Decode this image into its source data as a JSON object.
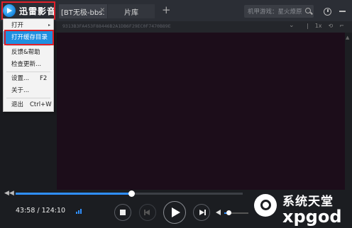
{
  "app": {
    "name": "迅雷影音"
  },
  "tabs": [
    {
      "label": "[BT无极-bbs.",
      "close": "✕"
    },
    {
      "label": "片库"
    }
  ],
  "tab_add": "+",
  "search": {
    "placeholder": "机甲游戏：星火燎原"
  },
  "address": {
    "hash": "9313B3FA453F88446B2A1DB6F29EC0F7470B89E",
    "chevron": "⌄",
    "tools": [
      "|",
      "1x",
      "⟲",
      "⌐"
    ]
  },
  "menu": {
    "items": [
      {
        "label": "打开",
        "arrow": "▸"
      },
      {
        "label": "打开缓存目录"
      },
      {
        "label": "反馈&帮助"
      },
      {
        "label": "检查更新..."
      },
      {
        "label": "设置...",
        "shortcut": "F2"
      },
      {
        "label": "关于..."
      },
      {
        "label": "退出",
        "shortcut": "Ctrl+W"
      }
    ]
  },
  "player": {
    "time": "43:58 / 124:10",
    "progress_fraction": 0.51,
    "volume_fraction": 0.18
  },
  "watermark": {
    "line1": "系统天堂",
    "line2": "xpgod"
  },
  "colors": {
    "accent": "#2f8fff",
    "highlight_border": "#e0202a",
    "menu_highlight": "#1f8fe0"
  }
}
